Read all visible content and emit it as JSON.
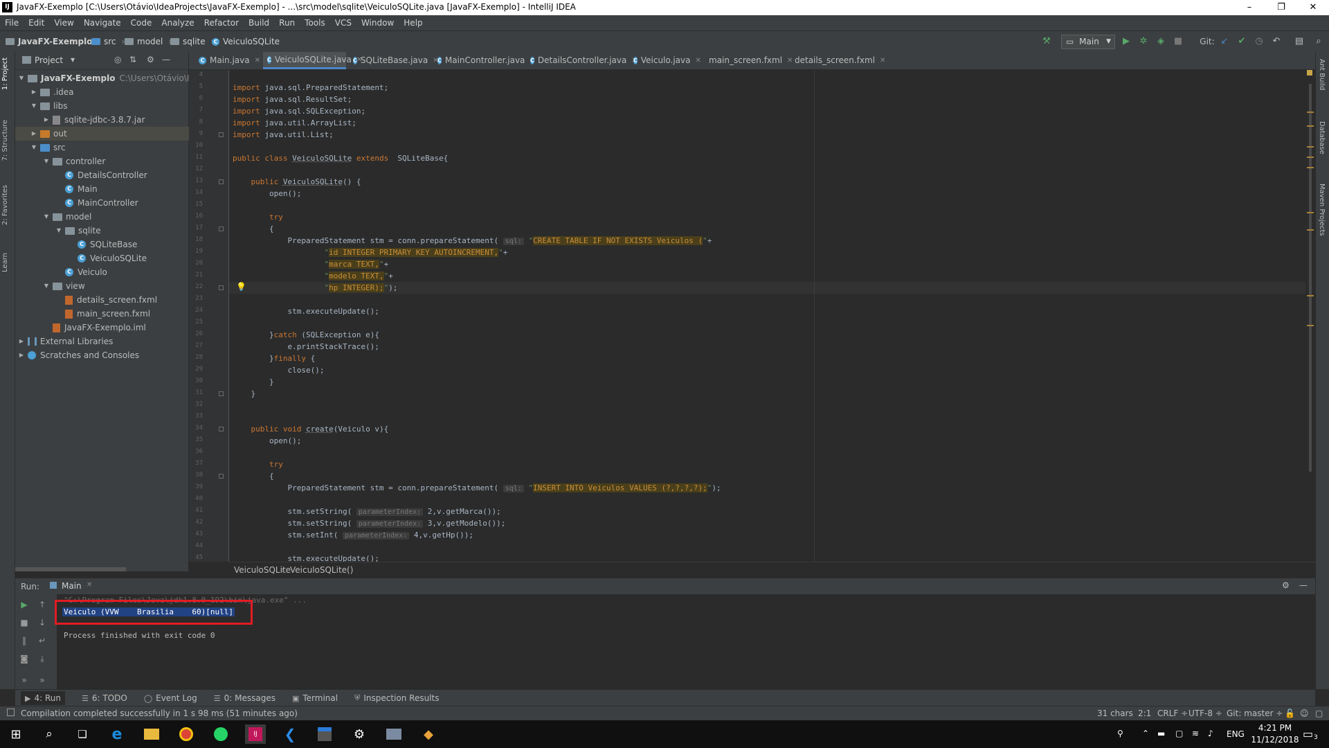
{
  "window": {
    "title": "JavaFX-Exemplo [C:\\Users\\Otávio\\IdeaProjects\\JavaFX-Exemplo] - ...\\src\\model\\sqlite\\VeiculoSQLite.java [JavaFX-Exemplo] - IntelliJ IDEA",
    "minimize": "–",
    "restore": "❐",
    "close": "✕"
  },
  "menu": [
    "File",
    "Edit",
    "View",
    "Navigate",
    "Code",
    "Analyze",
    "Refactor",
    "Build",
    "Run",
    "Tools",
    "VCS",
    "Window",
    "Help"
  ],
  "breadcrumb": [
    "JavaFX-Exemplo",
    "src",
    "model",
    "sqlite",
    "VeiculoSQLite"
  ],
  "toolbar": {
    "run_config": "Main",
    "git_label": "Git:"
  },
  "project_panel": {
    "title": "Project",
    "tree": [
      {
        "label": "JavaFX-Exemplo",
        "extra": "C:\\Users\\Otávio\\IdeaP",
        "depth": 0,
        "arrow": "▼",
        "icon": "folder"
      },
      {
        "label": ".idea",
        "depth": 1,
        "arrow": "▶",
        "icon": "folder"
      },
      {
        "label": "libs",
        "depth": 1,
        "arrow": "▼",
        "icon": "folder"
      },
      {
        "label": "sqlite-jdbc-3.8.7.jar",
        "depth": 2,
        "arrow": "▶",
        "icon": "jar"
      },
      {
        "label": "out",
        "depth": 1,
        "arrow": "▶",
        "icon": "folder-orange"
      },
      {
        "label": "src",
        "depth": 1,
        "arrow": "▼",
        "icon": "folder-blue"
      },
      {
        "label": "controller",
        "depth": 2,
        "arrow": "▼",
        "icon": "folder"
      },
      {
        "label": "DetailsController",
        "depth": 3,
        "arrow": "",
        "icon": "class"
      },
      {
        "label": "Main",
        "depth": 3,
        "arrow": "",
        "icon": "class"
      },
      {
        "label": "MainController",
        "depth": 3,
        "arrow": "",
        "icon": "class"
      },
      {
        "label": "model",
        "depth": 2,
        "arrow": "▼",
        "icon": "folder"
      },
      {
        "label": "sqlite",
        "depth": 3,
        "arrow": "▼",
        "icon": "folder"
      },
      {
        "label": "SQLiteBase",
        "depth": 4,
        "arrow": "",
        "icon": "class"
      },
      {
        "label": "VeiculoSQLite",
        "depth": 4,
        "arrow": "",
        "icon": "class"
      },
      {
        "label": "Veiculo",
        "depth": 3,
        "arrow": "",
        "icon": "class"
      },
      {
        "label": "view",
        "depth": 2,
        "arrow": "▼",
        "icon": "folder"
      },
      {
        "label": "details_screen.fxml",
        "depth": 3,
        "arrow": "",
        "icon": "file"
      },
      {
        "label": "main_screen.fxml",
        "depth": 3,
        "arrow": "",
        "icon": "file"
      },
      {
        "label": "JavaFX-Exemplo.iml",
        "depth": 2,
        "arrow": "",
        "icon": "file"
      },
      {
        "label": "External Libraries",
        "depth": 0,
        "arrow": "▶",
        "icon": "lib"
      },
      {
        "label": "Scratches and Consoles",
        "depth": 0,
        "arrow": "▶",
        "icon": "scratch"
      }
    ]
  },
  "editor_tabs": [
    {
      "label": "Main.java",
      "active": false
    },
    {
      "label": "VeiculoSQLite.java",
      "active": true
    },
    {
      "label": "SQLiteBase.java",
      "active": false
    },
    {
      "label": "MainController.java",
      "active": false
    },
    {
      "label": "DetailsController.java",
      "active": false
    },
    {
      "label": "Veiculo.java",
      "active": false
    },
    {
      "label": "main_screen.fxml",
      "active": false
    },
    {
      "label": "details_screen.fxml",
      "active": false
    }
  ],
  "code_lines": [
    {
      "n": "4",
      "html": ""
    },
    {
      "n": "5",
      "html": "<span class='kw'>import</span> java.sql.PreparedStatement;"
    },
    {
      "n": "6",
      "html": "<span class='kw'>import</span> java.sql.ResultSet;"
    },
    {
      "n": "7",
      "html": "<span class='kw'>import</span> java.sql.SQLException;"
    },
    {
      "n": "8",
      "html": "<span class='kw'>import</span> java.util.ArrayList;"
    },
    {
      "n": "9",
      "html": "<span class='kw'>import</span> java.util.List;"
    },
    {
      "n": "10",
      "html": ""
    },
    {
      "n": "11",
      "html": "<span class='kw'>public class</span> <span class='fn'>VeiculoSQLite</span> <span class='kw'>extends</span>  SQLiteBase{"
    },
    {
      "n": "12",
      "html": ""
    },
    {
      "n": "13",
      "html": "    <span class='kw'>public</span> <span class='fn'>VeiculoSQLite</span>() {"
    },
    {
      "n": "14",
      "html": "        open();"
    },
    {
      "n": "15",
      "html": ""
    },
    {
      "n": "16",
      "html": "        <span class='kw'>try</span>"
    },
    {
      "n": "17",
      "html": "        {"
    },
    {
      "n": "18",
      "html": "            PreparedStatement stm = conn.prepareStatement( <span class='hint'>sql:</span> <span class='str'>\"</span><span class='hl'>CREATE TABLE IF NOT EXISTS Veiculos (</span><span class='str'>\"</span>+"
    },
    {
      "n": "19",
      "html": "                    <span class='str'>\"</span><span class='hl'>id INTEGER PRIMARY KEY AUTOINCREMENT,</span><span class='str'>\"</span>+"
    },
    {
      "n": "20",
      "html": "                    <span class='str'>\"</span><span class='hl'>marca TEXT,</span><span class='str'>\"</span>+"
    },
    {
      "n": "21",
      "html": "                    <span class='str'>\"</span><span class='hl'>modelo TEXT,</span><span class='str'>\"</span>+"
    },
    {
      "n": "22",
      "html": "                    <span class='str'>\"</span><span class='hl'>hp INTEGER);</span><span class='str'>\"</span>);"
    },
    {
      "n": "23",
      "html": ""
    },
    {
      "n": "24",
      "html": "            stm.executeUpdate();"
    },
    {
      "n": "25",
      "html": ""
    },
    {
      "n": "26",
      "html": "        }<span class='kw'>catch</span> (SQLException e){"
    },
    {
      "n": "27",
      "html": "            e.printStackTrace();"
    },
    {
      "n": "28",
      "html": "        }<span class='kw'>finally</span> {"
    },
    {
      "n": "29",
      "html": "            close();"
    },
    {
      "n": "30",
      "html": "        }"
    },
    {
      "n": "31",
      "html": "    }"
    },
    {
      "n": "32",
      "html": ""
    },
    {
      "n": "33",
      "html": ""
    },
    {
      "n": "34",
      "html": "    <span class='kw'>public void</span> <span class='fn'>create</span>(Veiculo v){"
    },
    {
      "n": "35",
      "html": "        open();"
    },
    {
      "n": "36",
      "html": ""
    },
    {
      "n": "37",
      "html": "        <span class='kw'>try</span>"
    },
    {
      "n": "38",
      "html": "        {"
    },
    {
      "n": "39",
      "html": "            PreparedStatement stm = conn.prepareStatement( <span class='hint'>sql:</span> <span class='str'>\"</span><span class='hl'>INSERT INTO Veiculos VALUES (?,?,?,?);</span><span class='str'>\"</span>);"
    },
    {
      "n": "40",
      "html": ""
    },
    {
      "n": "41",
      "html": "            stm.setString( <span class='hint'>parameterIndex:</span> 2,v.getMarca());"
    },
    {
      "n": "42",
      "html": "            stm.setString( <span class='hint'>parameterIndex:</span> 3,v.getModelo());"
    },
    {
      "n": "43",
      "html": "            stm.setInt( <span class='hint'>parameterIndex:</span> 4,v.getHp());"
    },
    {
      "n": "44",
      "html": ""
    },
    {
      "n": "45",
      "html": "            stm.executeUpdate();"
    }
  ],
  "editor_breadcrumb": [
    "VeiculoSQLite",
    "VeiculoSQLite()"
  ],
  "run_panel": {
    "label": "Run:",
    "tab": "Main",
    "output": [
      "\"C:\\Program Files\\Java\\jdk1.8.0_192\\bin\\java.exe\" ...",
      "Veiculo (VVW    Brasilia    60)[null]",
      "",
      "Process finished with exit code 0"
    ]
  },
  "tool_tabs": [
    {
      "label": "4: Run",
      "glyph": "▶"
    },
    {
      "label": "6: TODO",
      "glyph": "☰"
    },
    {
      "label": "Event Log",
      "glyph": "◯"
    },
    {
      "label": "0: Messages",
      "glyph": "☰"
    },
    {
      "label": "Terminal",
      "glyph": "▣"
    },
    {
      "label": "Inspection Results",
      "glyph": "⛨"
    }
  ],
  "side_tabs_left": [
    "1: Project",
    "7: Structure",
    "2: Favorites",
    "Learn"
  ],
  "side_tabs_right": [
    "Ant Build",
    "Database",
    "Maven Projects"
  ],
  "status": {
    "message": "Compilation completed successfully in 1 s 98 ms (51 minutes ago)",
    "chars": "31 chars",
    "position": "2:1",
    "line_sep": "CRLF ÷",
    "encoding": "UTF-8 ÷",
    "git": "Git: master ÷"
  },
  "taskbar": {
    "lang": "ENG",
    "time": "4:21 PM",
    "date": "11/12/2018",
    "notif_count": "3"
  },
  "colors": {
    "accent": "#4a88c7",
    "highlight_box": "#e31b23",
    "selection": "#214283"
  }
}
